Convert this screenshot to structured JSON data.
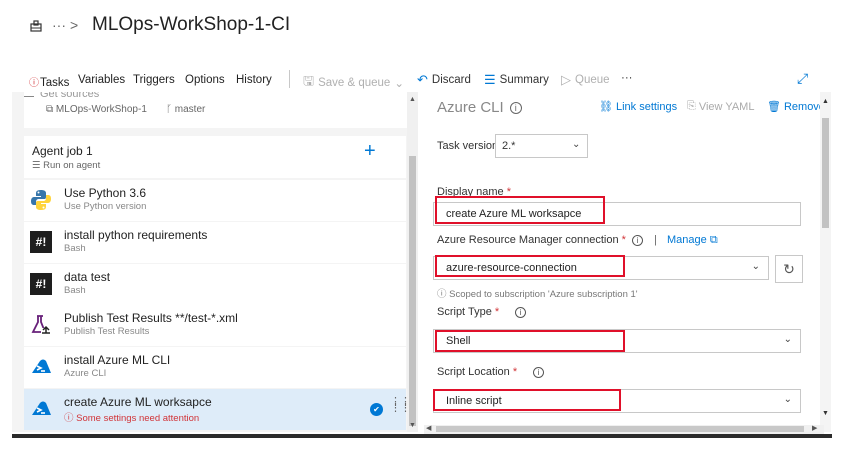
{
  "header": {
    "more": "···",
    "separator": ">",
    "title": "MLOps-WorkShop-1-CI"
  },
  "tabs": [
    {
      "label": "Tasks",
      "active": true,
      "icon": "warning-circle-icon"
    },
    {
      "label": "Variables"
    },
    {
      "label": "Triggers"
    },
    {
      "label": "Options"
    },
    {
      "label": "History"
    }
  ],
  "toolbar": {
    "save_queue": "Save & queue",
    "discard": "Discard",
    "summary": "Summary",
    "queue": "Queue",
    "more": "···"
  },
  "get_sources": {
    "title": "Get sources",
    "repo": "MLOps-WorkShop-1",
    "branch": "master"
  },
  "agent_job": {
    "name": "Agent job 1",
    "sub": "Run on agent",
    "add": "+"
  },
  "tasks": [
    {
      "name": "Use Python 3.6",
      "sub": "Use Python version",
      "icon": "python-icon"
    },
    {
      "name": "install python requirements",
      "sub": "Bash",
      "icon": "bash-icon"
    },
    {
      "name": "data test",
      "sub": "Bash",
      "icon": "bash-icon"
    },
    {
      "name": "Publish Test Results **/test-*.xml",
      "sub": "Publish Test Results",
      "icon": "flask-icon"
    },
    {
      "name": "install Azure ML CLI",
      "sub": "Azure CLI",
      "icon": "azure-cli-icon"
    },
    {
      "name": "create Azure ML worksapce",
      "sub": "Some settings need attention",
      "icon": "azure-cli-icon",
      "selected": true
    }
  ],
  "detail": {
    "title": "Azure CLI",
    "link_settings": "Link settings",
    "view_yaml": "View YAML",
    "remove": "Remove",
    "task_version_label": "Task version",
    "task_version_value": "2.*",
    "display_name_label": "Display name",
    "display_name_value": "create Azure ML worksapce",
    "arm_label": "Azure Resource Manager connection",
    "manage": "Manage",
    "arm_value": "azure-resource-connection",
    "scope_note": "Scoped to subscription 'Azure subscription 1'",
    "script_type_label": "Script Type",
    "script_type_value": "Shell",
    "script_location_label": "Script Location",
    "script_location_value": "Inline script",
    "required_mark": "*",
    "info_glyph": "i"
  },
  "colors": {
    "accent": "#0078d4",
    "highlight_box": "#e0102a",
    "selected_row": "#deecf9",
    "warning": "#d13438"
  }
}
